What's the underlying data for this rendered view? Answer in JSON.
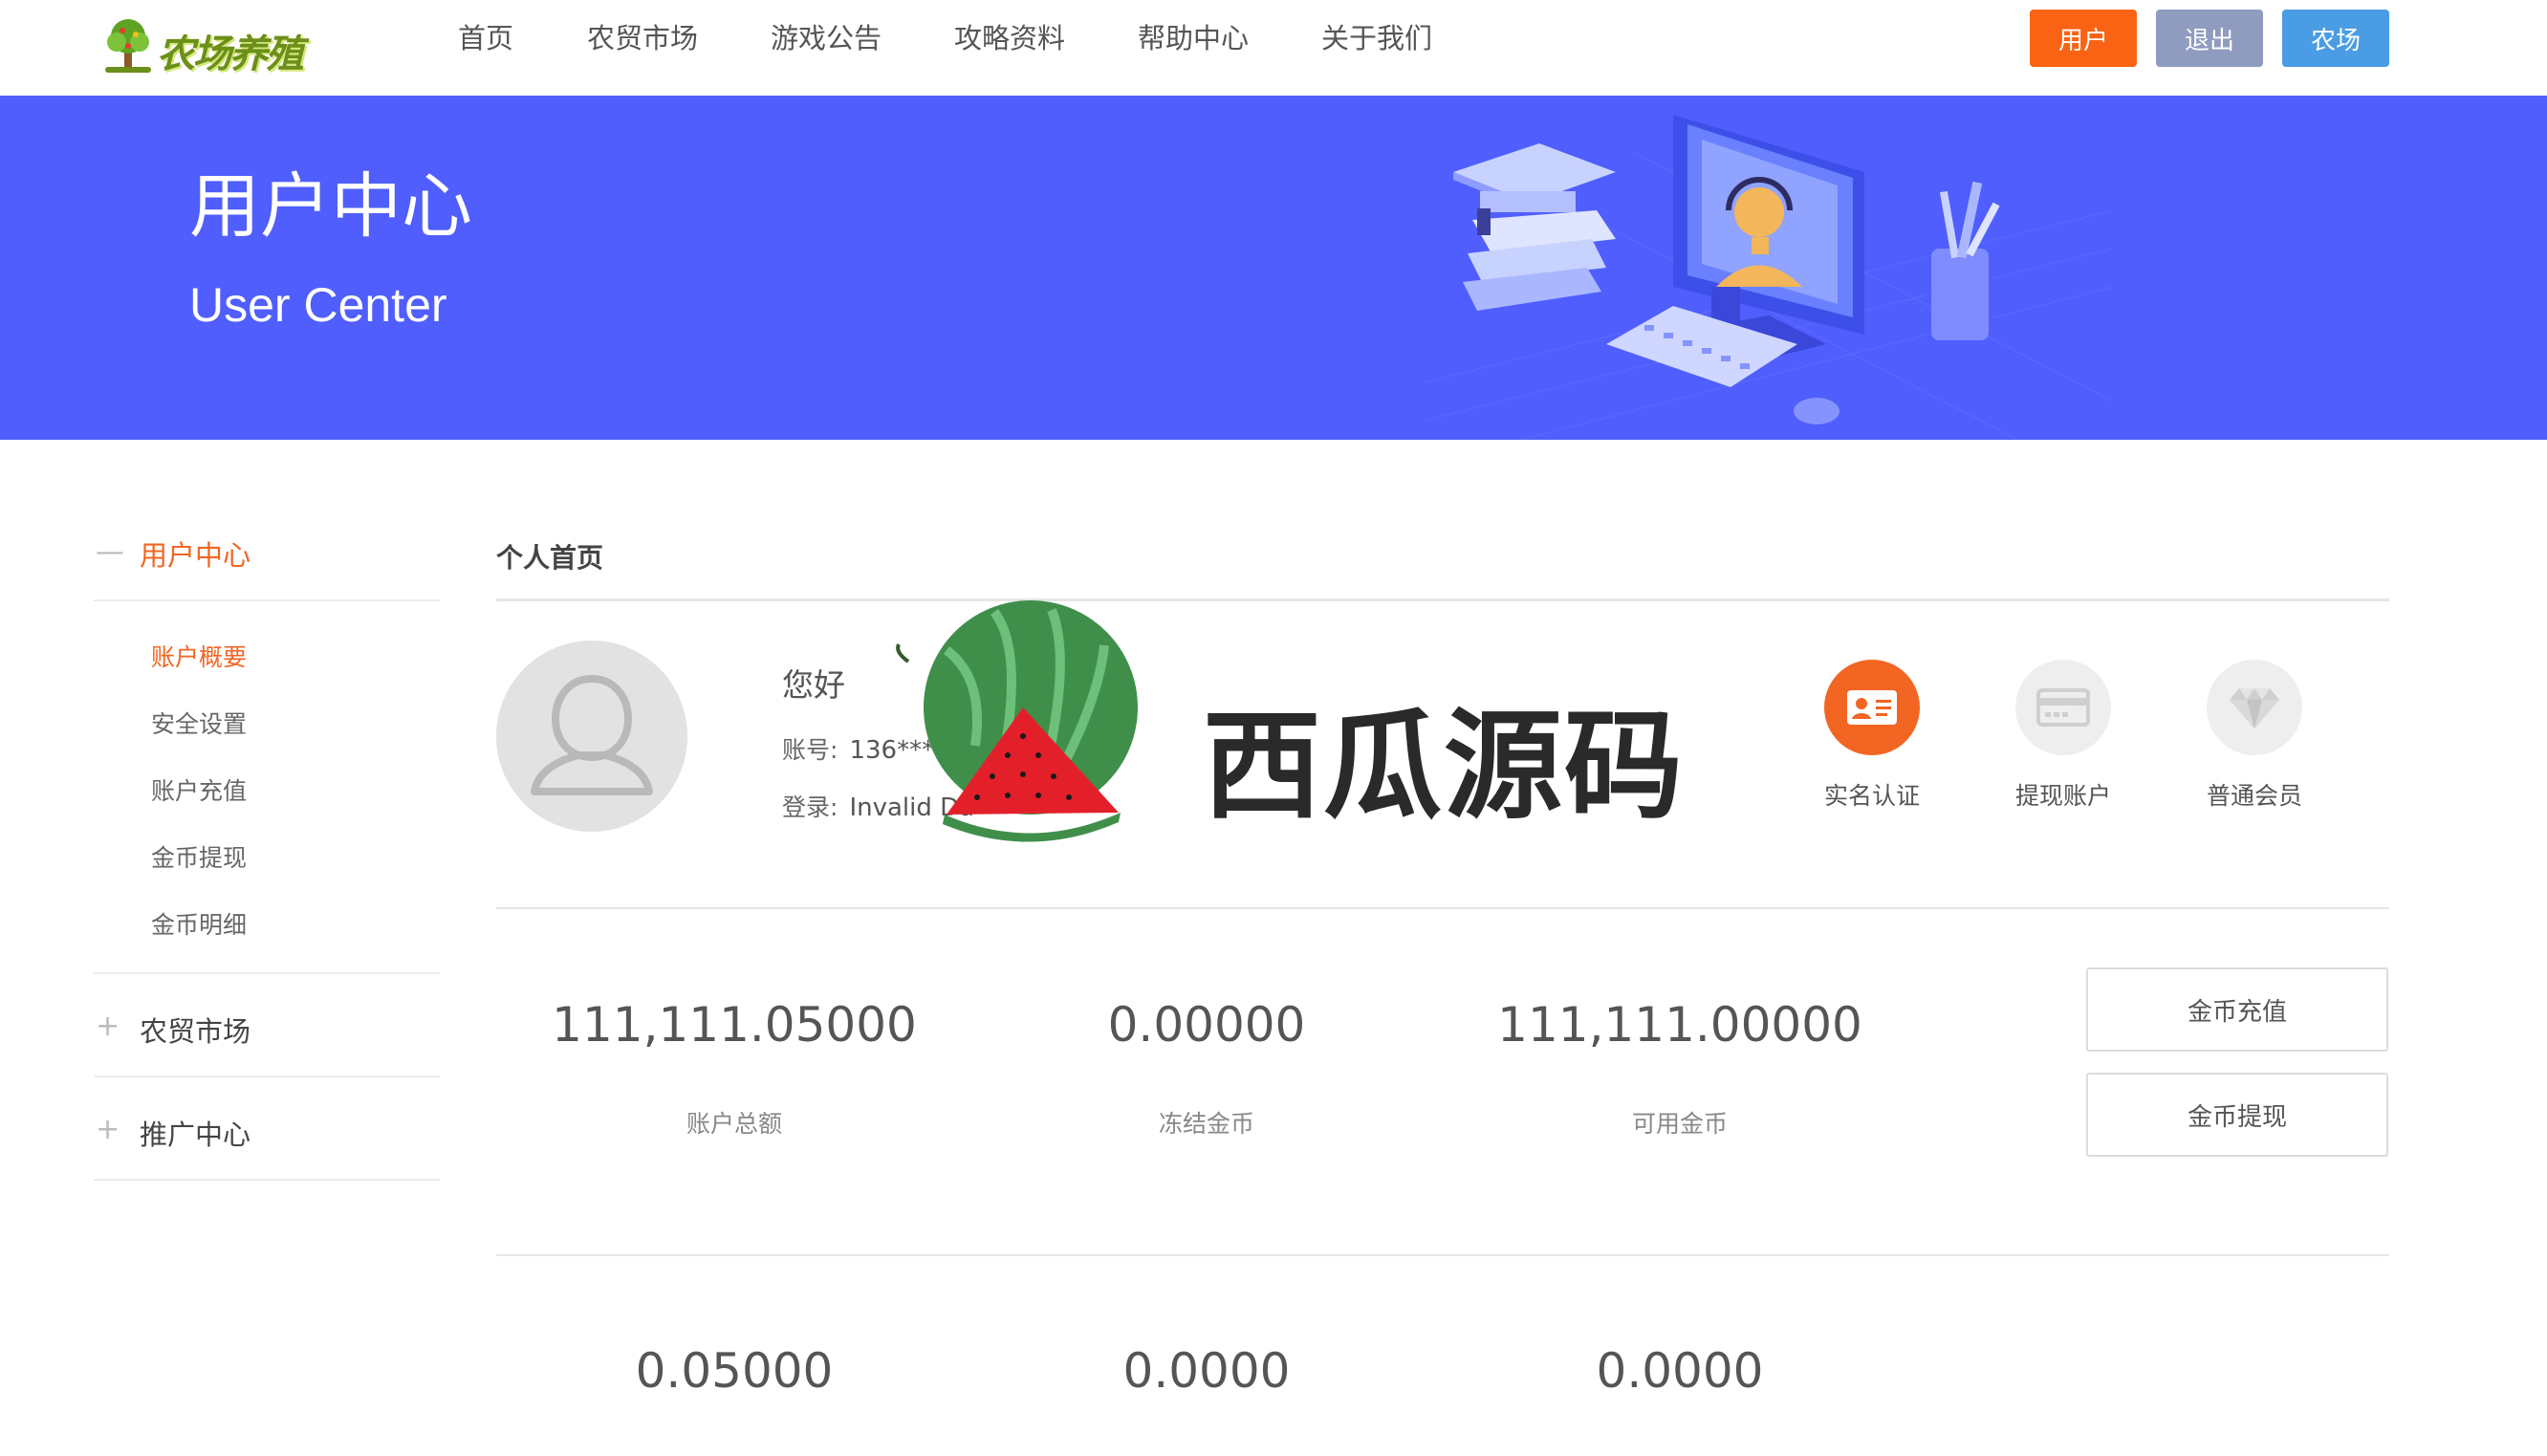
{
  "header": {
    "logo_text": "农场养殖",
    "nav": [
      "首页",
      "农贸市场",
      "游戏公告",
      "攻略资料",
      "帮助中心",
      "关于我们"
    ],
    "buttons": [
      {
        "label": "用户",
        "color": "#fa6314"
      },
      {
        "label": "退出",
        "color": "#8f9bbf"
      },
      {
        "label": "农场",
        "color": "#4a9de4"
      }
    ]
  },
  "banner": {
    "title": "用户中心",
    "subtitle": "User Center",
    "bg_color": "#4f5efc"
  },
  "sidebar": {
    "accent_color": "#f26522",
    "sections": [
      {
        "sign": "—",
        "label": "用户中心",
        "active": true
      },
      {
        "sign": "+",
        "label": "农贸市场",
        "active": false
      },
      {
        "sign": "+",
        "label": "推广中心",
        "active": false
      }
    ],
    "sub_items": [
      {
        "label": "账户概要",
        "active": true
      },
      {
        "label": "安全设置",
        "active": false
      },
      {
        "label": "账户充值",
        "active": false
      },
      {
        "label": "金币提现",
        "active": false
      },
      {
        "label": "金币明细",
        "active": false
      }
    ]
  },
  "main": {
    "title": "个人首页",
    "greeting": "您好",
    "account_label": "账号:",
    "account_value": "136***",
    "login_label": "登录:",
    "login_value": "Invalid Da",
    "badges": [
      {
        "label": "实名认证",
        "icon": "id-card-icon",
        "bg": "#f26522",
        "active": true
      },
      {
        "label": "提现账户",
        "icon": "bank-card-icon",
        "bg": "#eeeeee",
        "active": false
      },
      {
        "label": "普通会员",
        "icon": "diamond-icon",
        "bg": "#eeeeee",
        "active": false
      }
    ],
    "stats_row1": [
      {
        "value": "111,111.05000",
        "label": "账户总额"
      },
      {
        "value": "0.00000",
        "label": "冻结金币"
      },
      {
        "value": "111,111.00000",
        "label": "可用金币"
      }
    ],
    "stats_row2": [
      {
        "value": "0.05000"
      },
      {
        "value": "0.0000"
      },
      {
        "value": "0.0000"
      }
    ],
    "actions": [
      "金币充值",
      "金币提现"
    ]
  },
  "watermark": {
    "text": "西瓜源码"
  }
}
